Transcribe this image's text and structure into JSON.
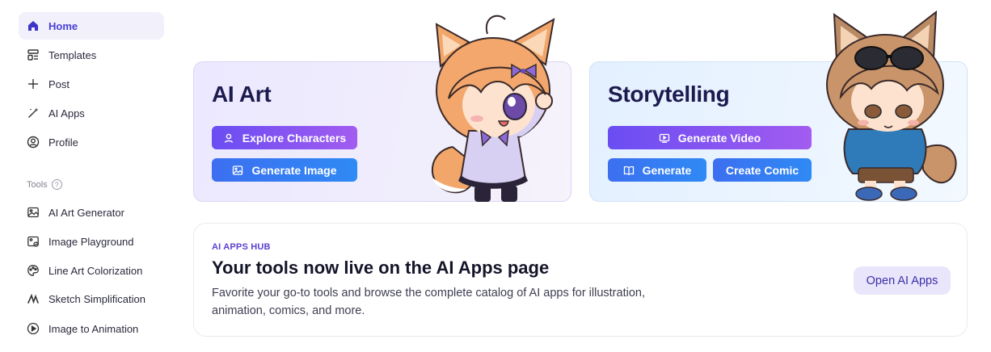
{
  "sidebar": {
    "items": [
      {
        "label": "Home",
        "icon": "home-icon",
        "active": true
      },
      {
        "label": "Templates",
        "icon": "templates-icon"
      },
      {
        "label": "Post",
        "icon": "plus-icon"
      },
      {
        "label": "AI Apps",
        "icon": "magic-wand-icon"
      },
      {
        "label": "Profile",
        "icon": "user-circle-icon"
      }
    ],
    "tools_heading": "Tools",
    "tools_help": "?",
    "tools": [
      {
        "label": "AI Art Generator",
        "icon": "image-icon"
      },
      {
        "label": "Image Playground",
        "icon": "image-edit-icon"
      },
      {
        "label": "Line Art Colorization",
        "icon": "palette-icon"
      },
      {
        "label": "Sketch Simplification",
        "icon": "sketch-icon"
      },
      {
        "label": "Image to Animation",
        "icon": "play-circle-icon"
      }
    ]
  },
  "cards": {
    "ai_art": {
      "title": "AI Art",
      "explore_label": "Explore Characters",
      "generate_image_label": "Generate Image"
    },
    "storytelling": {
      "title": "Storytelling",
      "generate_video_label": "Generate Video",
      "generate_label": "Generate",
      "create_comic_label": "Create Comic"
    }
  },
  "hub": {
    "eyebrow": "AI APPS HUB",
    "title": "Your tools now live on the AI Apps page",
    "description": "Favorite your go-to tools and browse the complete catalog of AI apps for illustration, animation, comics, and more.",
    "button_label": "Open AI Apps"
  },
  "colors": {
    "accent": "#4a3fd6",
    "purple_button": "#7b50f0",
    "blue_button": "#3a78f2",
    "hub_button_bg": "#e9e5fb"
  }
}
